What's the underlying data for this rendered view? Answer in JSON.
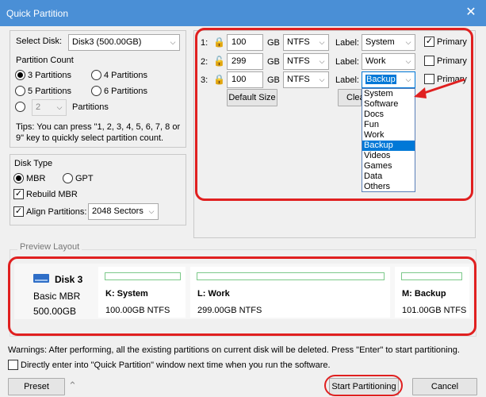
{
  "window": {
    "title": "Quick Partition",
    "close_glyph": "✕"
  },
  "left": {
    "select_disk_label": "Select Disk:",
    "select_disk_value": "Disk3 (500.00GB)",
    "partition_count_label": "Partition Count",
    "options": [
      "3 Partitions",
      "4 Partitions",
      "5 Partitions",
      "6 Partitions"
    ],
    "custom_count": "2",
    "custom_label": "Partitions",
    "tips": "Tips: You can press \"1, 2, 3, 4, 5, 6, 7, 8 or 9\" key to quickly select partition count."
  },
  "disk_type": {
    "title": "Disk Type",
    "mbr": "MBR",
    "gpt": "GPT",
    "rebuild": "Rebuild MBR",
    "align": "Align Partitions:",
    "align_value": "2048 Sectors"
  },
  "partitions": [
    {
      "num": "1:",
      "size": "100",
      "unit": "GB",
      "fs": "NTFS",
      "label_text": "Label:",
      "label": "System",
      "primary": "Primary",
      "primary_checked": true
    },
    {
      "num": "2:",
      "size": "299",
      "unit": "GB",
      "fs": "NTFS",
      "label_text": "Label:",
      "label": "Work",
      "primary": "Primary",
      "primary_checked": false
    },
    {
      "num": "3:",
      "size": "100",
      "unit": "GB",
      "fs": "NTFS",
      "label_text": "Label:",
      "label": "Backup",
      "primary": "Primary",
      "primary_checked": false
    }
  ],
  "buttons": {
    "default_size": "Default Size",
    "clear": "Clea",
    "preset": "Preset",
    "start": "Start Partitioning",
    "cancel": "Cancel"
  },
  "label_options": [
    "System",
    "Software",
    "Docs",
    "Fun",
    "Work",
    "Backup",
    "Videos",
    "Games",
    "Data",
    "Others"
  ],
  "label_selected": "Backup",
  "preview": {
    "title": "Preview Layout",
    "disk_name": "Disk 3",
    "disk_type": "Basic MBR",
    "disk_size": "500.00GB",
    "cards": [
      {
        "name": "K: System",
        "detail": "100.00GB NTFS"
      },
      {
        "name": "L: Work",
        "detail": "299.00GB NTFS"
      },
      {
        "name": "M: Backup",
        "detail": "101.00GB NTFS"
      }
    ]
  },
  "warning": "Warnings: After performing, all the existing partitions on current disk will be deleted. Press \"Enter\" to start partitioning.",
  "direct_enter": "Directly enter into \"Quick Partition\" window next time when you run the software.",
  "colors": {
    "accent": "#0078d7",
    "highlight": "#e02020",
    "titlebar": "#4a8fd6",
    "bar": "#7cc98a"
  }
}
